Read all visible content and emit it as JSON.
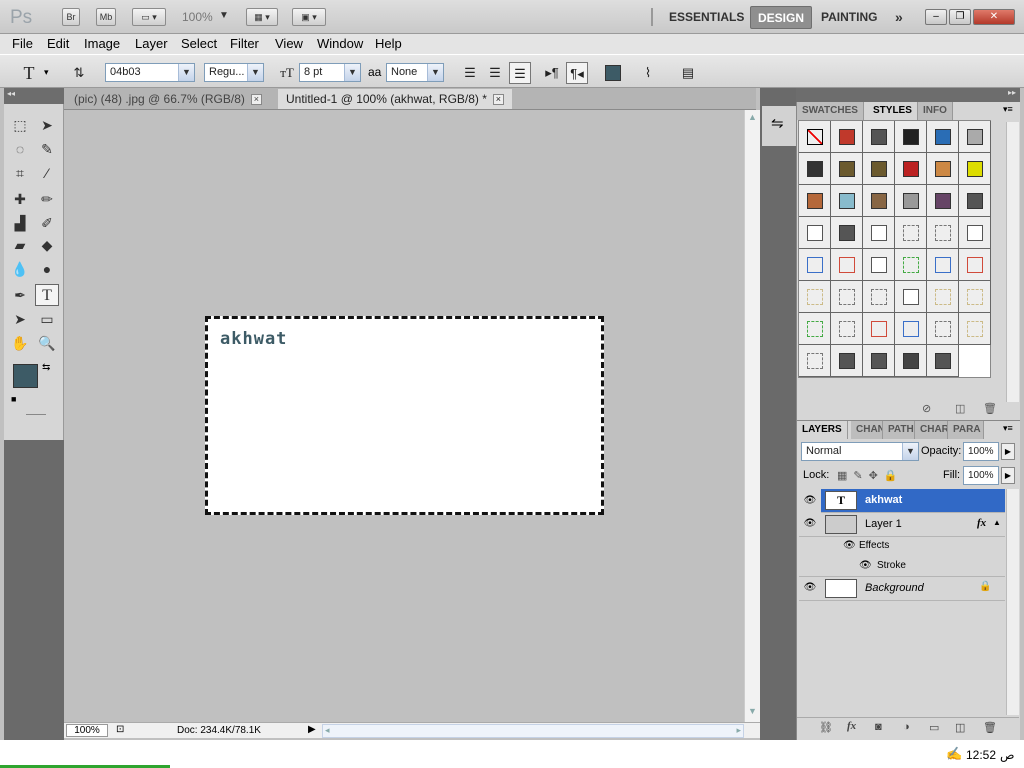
{
  "app": {
    "logo": "Ps",
    "bridge": "Br",
    "mini_bridge": "Mb",
    "zoom": "100%",
    "workspaces": [
      "ESSENTIALS",
      "DESIGN",
      "PAINTING"
    ],
    "more_workspaces": "»",
    "active_workspace": "DESIGN"
  },
  "menu": [
    "File",
    "Edit",
    "Image",
    "Layer",
    "Select",
    "Filter",
    "View",
    "Window",
    "Help"
  ],
  "options": {
    "tool_glyph": "T",
    "font_family": "04b03",
    "font_style": "Regu...",
    "font_size": "8 pt",
    "aa_label": "aa",
    "antialias": "None",
    "text_color": "#3d5b66"
  },
  "tabs": [
    {
      "label": "(pic) (48) .jpg @ 66.7% (RGB/8)"
    },
    {
      "label": "Untitled-1 @ 100% (akhwat, RGB/8) *"
    }
  ],
  "canvas": {
    "text": "akhwat"
  },
  "status": {
    "zoom": "100%",
    "doc": "Doc: 234.4K/78.1K"
  },
  "colors": {
    "foreground": "#3d5b66",
    "background": "#d4d0c8"
  },
  "styles_panel": {
    "tabs": [
      "SWATCHES",
      "STYLES",
      "INFO"
    ],
    "active": "STYLES"
  },
  "layers_panel": {
    "tabs": [
      "LAYERS",
      "CHAN",
      "PATH",
      "CHAR",
      "PARA"
    ],
    "blend_mode": "Normal",
    "opacity_label": "Opacity:",
    "opacity": "100%",
    "lock_label": "Lock:",
    "fill_label": "Fill:",
    "fill": "100%",
    "layers": [
      {
        "name": "akhwat",
        "type": "text",
        "selected": true
      },
      {
        "name": "Layer 1",
        "type": "layer",
        "fx": "fx"
      },
      {
        "name": "Effects",
        "type": "effects"
      },
      {
        "name": "Stroke",
        "type": "effect"
      },
      {
        "name": "Background",
        "type": "background"
      }
    ]
  },
  "taskbar": {
    "time": "12:52",
    "ampm": "ص"
  }
}
